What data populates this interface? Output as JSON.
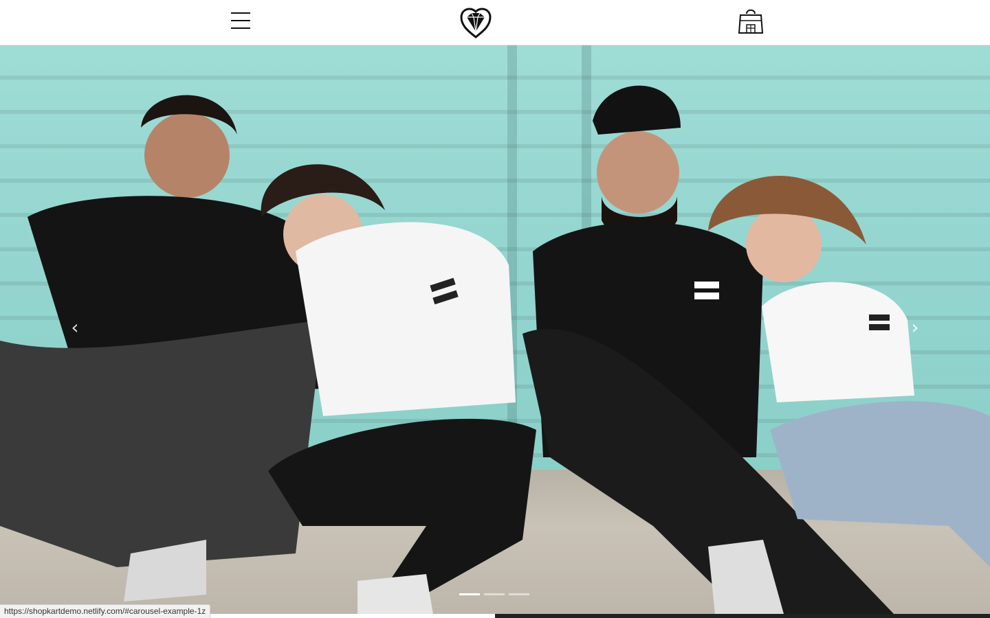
{
  "header": {
    "menu_icon": "hamburger-menu-icon",
    "logo_icon": "diamond-heart-logo-icon",
    "cart_icon": "shopping-bag-icon"
  },
  "carousel": {
    "slide_image": "Four people in black and white t-shirts sitting against a teal wall",
    "prev_icon": "chevron-left-icon",
    "prev_glyph": "‹",
    "next_icon": "chevron-right-icon",
    "next_glyph": "›",
    "indicator_count": 3,
    "active_indicator": 0
  },
  "status_bar": {
    "url": "https://shopkartdemo.netlify.com/#carousel-example-1z"
  },
  "colors": {
    "wall": "#8fd3cc",
    "floor": "#c2bbb0",
    "header_bg": "#ffffff",
    "bottom_right": "#1e2220"
  }
}
